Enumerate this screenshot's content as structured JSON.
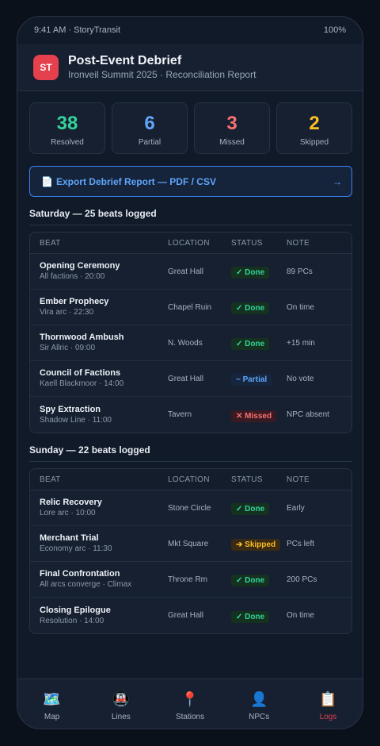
{
  "status": {
    "left": "9:41 AM · StoryTransit",
    "right": "100%"
  },
  "header": {
    "logo": "ST",
    "title": "Post-Event Debrief",
    "subtitle": "Ironveil Summit 2025 · Reconciliation Report"
  },
  "stats": [
    {
      "value": "38",
      "label": "Resolved",
      "color": "#34d399"
    },
    {
      "value": "6",
      "label": "Partial",
      "color": "#60a5fa"
    },
    {
      "value": "3",
      "label": "Missed",
      "color": "#f87171"
    },
    {
      "value": "2",
      "label": "Skipped",
      "color": "#fbbf24"
    }
  ],
  "export": {
    "icon": "document-icon",
    "label": "Export Debrief Report — PDF / CSV",
    "arrow": "→"
  },
  "columns": {
    "beat": "BEAT",
    "location": "LOCATION",
    "status": "STATUS",
    "note": "NOTE"
  },
  "saturday": {
    "title": "Saturday — 25 beats logged",
    "rows": [
      {
        "name": "Opening Ceremony",
        "sub": "All factions · 20:00",
        "location": "Great Hall",
        "status": "✓ Done",
        "kind": "done",
        "note": "89 PCs"
      },
      {
        "name": "Ember Prophecy",
        "sub": "Vira arc · 22:30",
        "location": "Chapel Ruin",
        "status": "✓ Done",
        "kind": "done",
        "note": "On time"
      },
      {
        "name": "Thornwood Ambush",
        "sub": "Sir Allric · 09:00",
        "location": "N. Woods",
        "status": "✓ Done",
        "kind": "done",
        "note": "+15 min"
      },
      {
        "name": "Council of Factions",
        "sub": "Kaell Blackmoor · 14:00",
        "location": "Great Hall",
        "status": "~ Partial",
        "kind": "partial",
        "note": "No vote"
      },
      {
        "name": "Spy Extraction",
        "sub": "Shadow Line · 11:00",
        "location": "Tavern",
        "status": "✕ Missed",
        "kind": "missed",
        "note": "NPC absent"
      }
    ]
  },
  "sunday": {
    "title": "Sunday — 22 beats logged",
    "rows": [
      {
        "name": "Relic Recovery",
        "sub": "Lore arc · 10:00",
        "location": "Stone Circle",
        "status": "✓ Done",
        "kind": "done",
        "note": "Early"
      },
      {
        "name": "Merchant Trial",
        "sub": "Economy arc · 11:30",
        "location": "Mkt Square",
        "status": "➔ Skipped",
        "kind": "skipped",
        "note": "PCs left"
      },
      {
        "name": "Final Confrontation",
        "sub": "All arcs converge · Climax",
        "location": "Throne Rm",
        "status": "✓ Done",
        "kind": "done",
        "note": "200 PCs"
      },
      {
        "name": "Closing Epilogue",
        "sub": "Resolution · 14:00",
        "location": "Great Hall",
        "status": "✓ Done",
        "kind": "done",
        "note": "On time"
      }
    ]
  },
  "nav": [
    {
      "label": "Map",
      "icon": "🗺️",
      "icon_name": "map-icon",
      "active": false
    },
    {
      "label": "Lines",
      "icon": "🚇",
      "icon_name": "metro-icon",
      "active": false
    },
    {
      "label": "Stations",
      "icon": "📍",
      "icon_name": "pin-icon",
      "active": false
    },
    {
      "label": "NPCs",
      "icon": "👤",
      "icon_name": "person-icon",
      "active": false
    },
    {
      "label": "Logs",
      "icon": "📋",
      "icon_name": "clipboard-icon",
      "active": true
    }
  ],
  "colors": {
    "accent": "#e5404e",
    "link": "#60a5fa",
    "background": "#111a28"
  }
}
